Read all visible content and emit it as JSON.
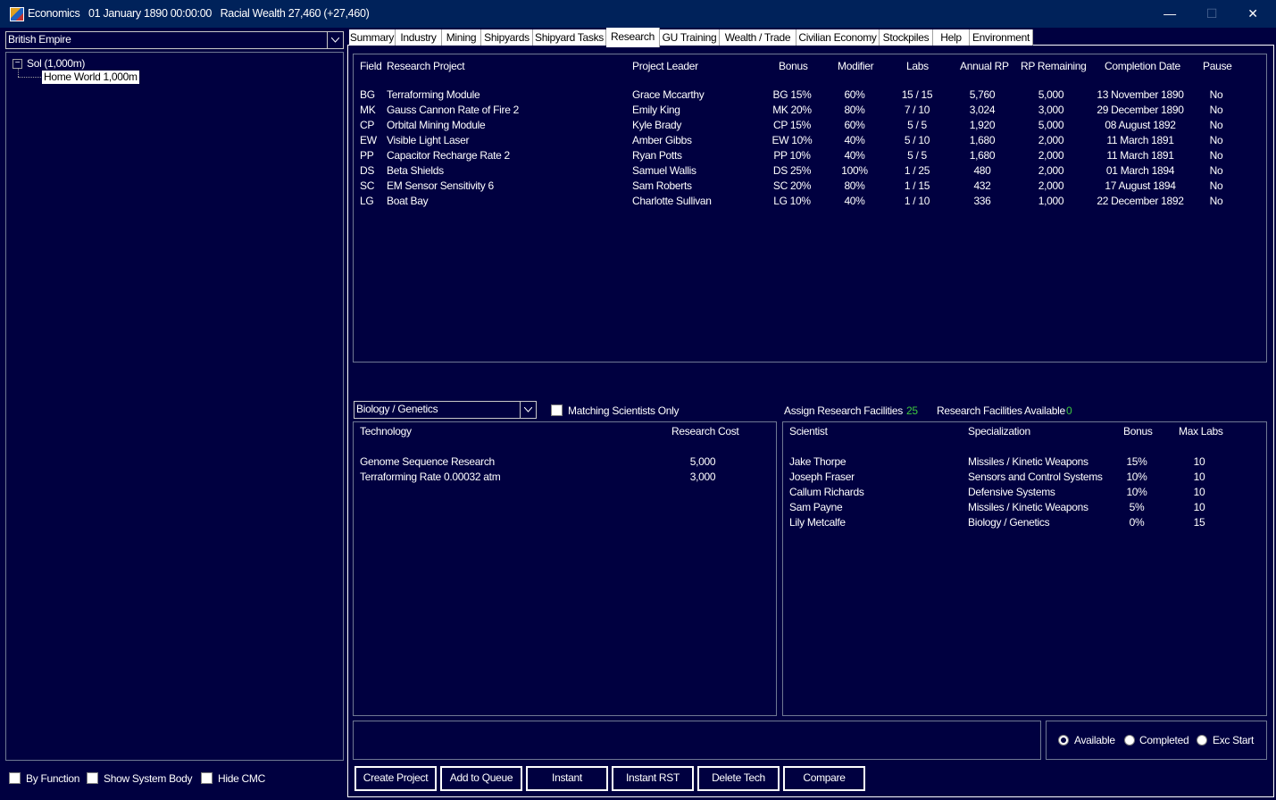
{
  "window": {
    "title": "Economics",
    "date": "01 January 1890 00:00:00",
    "wealth": "Racial Wealth 27,460 (+27,460)",
    "minimize": "—",
    "maximize": "☐",
    "close": "✕"
  },
  "left": {
    "empire": "British Empire",
    "tree": {
      "system": "Sol  (1,000m)",
      "body": "Home World  1,000m",
      "expander": "−"
    },
    "options": {
      "by_function": "By Function",
      "show_system_body": "Show System Body",
      "hide_cmc": "Hide CMC"
    }
  },
  "tabs": [
    "Summary",
    "Industry",
    "Mining",
    "Shipyards",
    "Shipyard Tasks",
    "Research",
    "GU Training",
    "Wealth / Trade",
    "Civilian Economy",
    "Stockpiles",
    "Help",
    "Environment"
  ],
  "projects": {
    "headers": [
      "Field",
      "Research Project",
      "Project Leader",
      "Bonus",
      "Modifier",
      "Labs",
      "Annual RP",
      "RP Remaining",
      "Completion Date",
      "Pause"
    ],
    "rows": [
      [
        "BG",
        "Terraforming Module",
        "Grace Mccarthy",
        "BG 15%",
        "60%",
        "15 / 15",
        "5,760",
        "5,000",
        "13 November 1890",
        "No"
      ],
      [
        "MK",
        "Gauss Cannon Rate of Fire 2",
        "Emily King",
        "MK 20%",
        "80%",
        "7 / 10",
        "3,024",
        "3,000",
        "29 December 1890",
        "No"
      ],
      [
        "CP",
        "Orbital Mining Module",
        "Kyle Brady",
        "CP 15%",
        "60%",
        "5 / 5",
        "1,920",
        "5,000",
        "08 August 1892",
        "No"
      ],
      [
        "EW",
        "Visible Light Laser",
        "Amber Gibbs",
        "EW 10%",
        "40%",
        "5 / 10",
        "1,680",
        "2,000",
        "11 March 1891",
        "No"
      ],
      [
        "PP",
        "Capacitor Recharge Rate 2",
        "Ryan Potts",
        "PP 10%",
        "40%",
        "5 / 5",
        "1,680",
        "2,000",
        "11 March 1891",
        "No"
      ],
      [
        "DS",
        "Beta Shields",
        "Samuel Wallis",
        "DS 25%",
        "100%",
        "1 / 25",
        "480",
        "2,000",
        "01 March 1894",
        "No"
      ],
      [
        "SC",
        "EM Sensor Sensitivity 6",
        "Sam Roberts",
        "SC 20%",
        "80%",
        "1 / 15",
        "432",
        "2,000",
        "17 August 1894",
        "No"
      ],
      [
        "LG",
        "Boat Bay",
        "Charlotte Sullivan",
        "LG 10%",
        "40%",
        "1 / 10",
        "336",
        "1,000",
        "22 December 1892",
        "No"
      ]
    ]
  },
  "filters": {
    "field": "Biology / Genetics",
    "matching_scientists": "Matching Scientists Only",
    "assign_label": "Assign Research Facilities",
    "assign_value": "25",
    "available_label": "Research Facilities Available",
    "available_value": "0"
  },
  "tech": {
    "headers": [
      "Technology",
      "Research Cost"
    ],
    "rows": [
      [
        "Genome Sequence Research",
        "5,000"
      ],
      [
        "Terraforming Rate 0.00032 atm",
        "3,000"
      ]
    ]
  },
  "scientists": {
    "headers": [
      "Scientist",
      "Specialization",
      "Bonus",
      "Max Labs"
    ],
    "rows": [
      [
        "Jake Thorpe",
        "Missiles / Kinetic Weapons",
        "15%",
        "10"
      ],
      [
        "Joseph Fraser",
        "Sensors and Control Systems",
        "10%",
        "10"
      ],
      [
        "Callum Richards",
        "Defensive Systems",
        "10%",
        "10"
      ],
      [
        "Sam Payne",
        "Missiles / Kinetic Weapons",
        "5%",
        "10"
      ],
      [
        "Lily Metcalfe",
        "Biology / Genetics",
        "0%",
        "15"
      ]
    ]
  },
  "radios": {
    "available": "Available",
    "completed": "Completed",
    "exc_start": "Exc Start",
    "selected": "available"
  },
  "buttons": [
    "Create Project",
    "Add to Queue",
    "Instant",
    "Instant RST",
    "Delete Tech",
    "Compare"
  ]
}
